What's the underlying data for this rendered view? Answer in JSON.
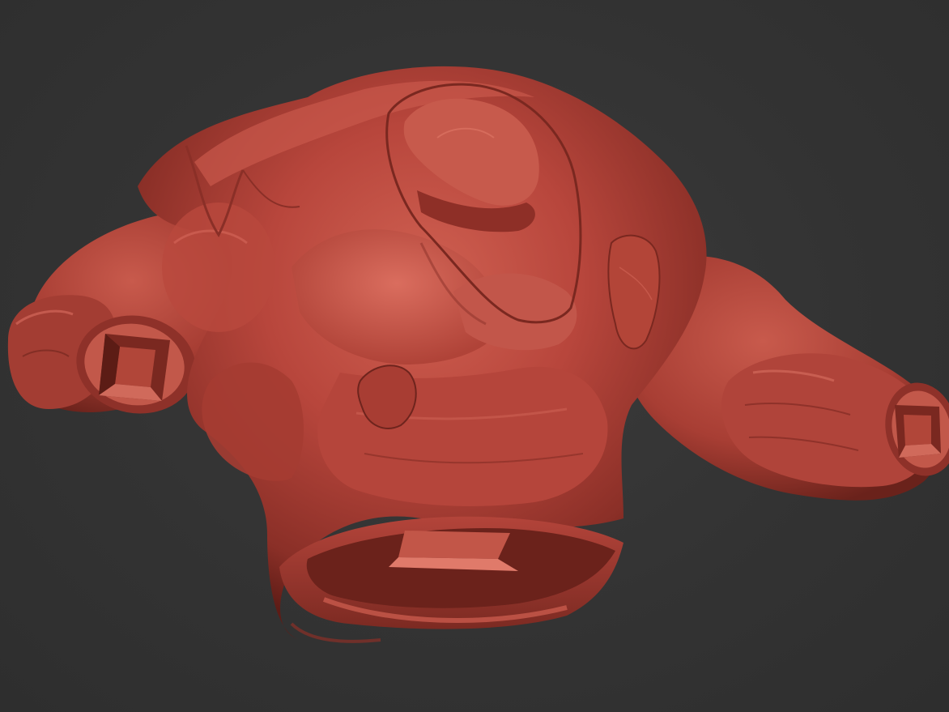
{
  "viewport": {
    "background_color": "#333333"
  },
  "model": {
    "subject": "sculpted-torso",
    "material_color": "#b8463c",
    "highlight_color": "#d9685a",
    "shadow_color": "#5e1c16"
  }
}
